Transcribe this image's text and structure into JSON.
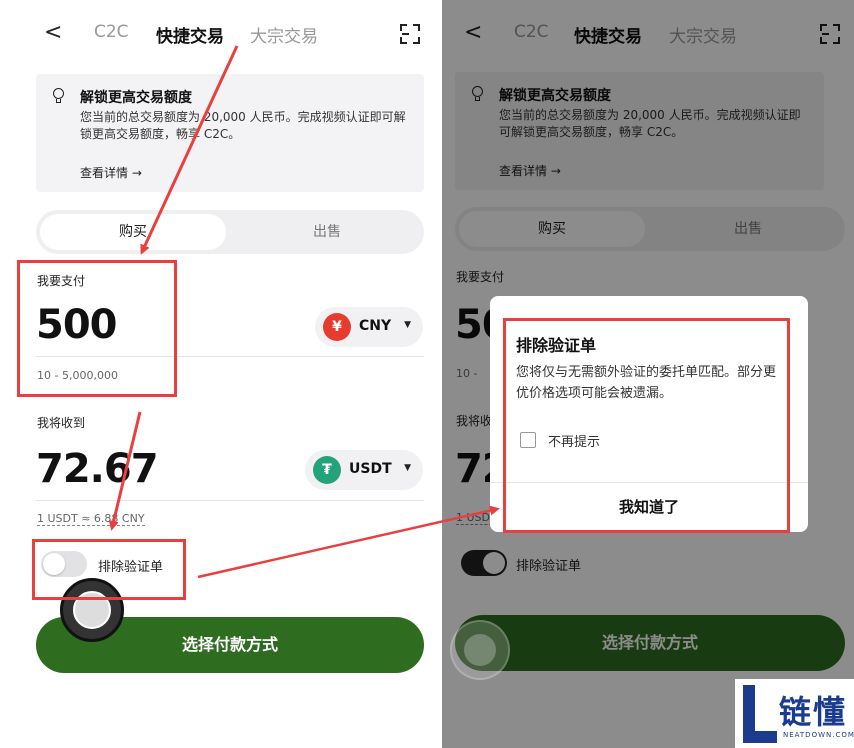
{
  "nav": {
    "back": "<",
    "tabs": [
      "C2C",
      "快捷交易",
      "大宗交易"
    ]
  },
  "banner": {
    "title": "解锁更高交易额度",
    "body": "您当前的总交易额度为 20,000 人民币。完成视频认证即可解锁更高交易额度，畅享 C2C。",
    "more": "查看详情 →"
  },
  "segment": {
    "buy": "购买",
    "sell": "出售"
  },
  "pay": {
    "label": "我要支付",
    "amount": "500",
    "currency": "CNY",
    "coin_symbol": "¥",
    "range": "10 - 5,000,000"
  },
  "receive": {
    "label": "我将收到",
    "amount": "72.67",
    "currency": "USDT",
    "coin_symbol": "₮",
    "rate": "1 USDT ≈ 6.88 CNY"
  },
  "exclude_toggle": {
    "label": "排除验证单",
    "left_state": "off",
    "right_state": "on"
  },
  "cta": {
    "label": "选择付款方式"
  },
  "dialog": {
    "title": "排除验证单",
    "body": "您将仅与无需额外验证的委托单匹配。部分更优价格选项可能会被遗漏。",
    "checkbox_label": "不再提示",
    "button": "我知道了"
  },
  "right_partial": {
    "pay_amount": "50",
    "range_prefix": "10 -",
    "receive_label": "我将收",
    "receive_amount": "72",
    "rate_prefix": "1 USDT"
  },
  "watermark": {
    "text": "链懂",
    "sub": "NEATDOWN.COM"
  },
  "colors": {
    "accent_green": "#2e6c1f",
    "annotation_red": "#e8403f",
    "cny_red": "#e63b2e",
    "usdt_green": "#24a37b",
    "brand_blue": "#1b3b8f"
  }
}
